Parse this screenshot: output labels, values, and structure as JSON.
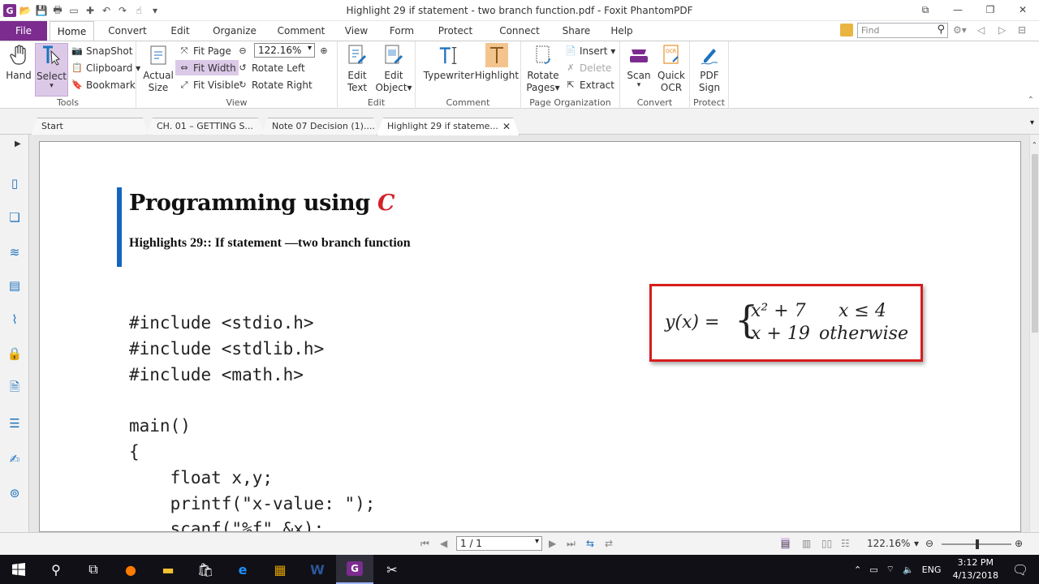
{
  "window": {
    "title": "Highlight 29 if statement - two branch function.pdf - Foxit PhantomPDF"
  },
  "menu_tabs": [
    "File",
    "Home",
    "Convert",
    "Edit",
    "Organize",
    "Comment",
    "View",
    "Form",
    "Protect",
    "Connect",
    "Share",
    "Help"
  ],
  "search": {
    "placeholder": "Find"
  },
  "ribbon": {
    "tools": {
      "label": "Tools",
      "hand": "Hand",
      "select": "Select",
      "snapshot": "SnapShot",
      "clipboard": "Clipboard",
      "bookmark": "Bookmark"
    },
    "view": {
      "label": "View",
      "actual": "Actual",
      "size": "Size",
      "fit_page": "Fit Page",
      "fit_width": "Fit Width",
      "fit_visible": "Fit Visible",
      "zoom": "122.16%",
      "rotate_left": "Rotate Left",
      "rotate_right": "Rotate Right"
    },
    "edit": {
      "label": "Edit",
      "edit_text_1": "Edit",
      "edit_text_2": "Text",
      "edit_object_1": "Edit",
      "edit_object_2": "Object"
    },
    "comment": {
      "label": "Comment",
      "typewriter": "Typewriter",
      "highlight": "Highlight"
    },
    "page_org": {
      "label": "Page Organization",
      "rotate_1": "Rotate",
      "rotate_2": "Pages",
      "insert": "Insert",
      "delete": "Delete",
      "extract": "Extract"
    },
    "convert": {
      "label": "Convert",
      "scan": "Scan",
      "quick_1": "Quick",
      "quick_2": "OCR"
    },
    "protect": {
      "label": "Protect",
      "pdf_1": "PDF",
      "pdf_2": "Sign"
    }
  },
  "doc_tabs": [
    "Start",
    "CH. 01 – GETTING S...",
    "Note 07 Decision (1)....",
    "Highlight 29 if stateme..."
  ],
  "document": {
    "title_text": "Programming using ",
    "title_c": "C",
    "subtitle": "Highlights 29:: If statement —two branch function",
    "code": "#include <stdio.h>\n#include <stdlib.h>\n#include <math.h>\n\nmain()\n{\n    float x,y;\n    printf(\"x-value: \");\n    scanf(\"%f\",&x);",
    "equation": {
      "lhs": "y(x) =",
      "case1": "x² + 7",
      "cond1": "x ≤ 4",
      "case2": "x + 19",
      "cond2": "otherwise"
    }
  },
  "status": {
    "page": "1 / 1",
    "zoom": "122.16%",
    "zoom_fraction": 0.5
  },
  "taskbar": {
    "lang": "ENG",
    "time": "3:12 PM",
    "date": "4/13/2018"
  },
  "colors": {
    "accent": "#7b2c8e",
    "title_bar": "#1565c0",
    "equation_border": "#d71c1c",
    "c_red": "#d2232a"
  }
}
